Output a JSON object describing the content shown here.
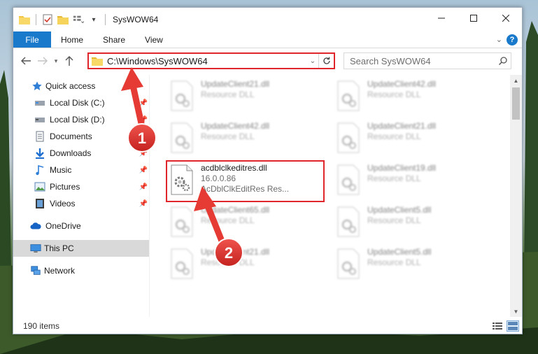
{
  "window": {
    "title": "SysWOW64",
    "controls": {
      "minimize": "—",
      "maximize": "☐",
      "close": "✕"
    }
  },
  "ribbon": {
    "tabs": [
      "File",
      "Home",
      "Share",
      "View"
    ],
    "help": "?"
  },
  "address": {
    "path": "C:\\Windows\\SysWOW64",
    "search_placeholder": "Search SysWOW64"
  },
  "nav": {
    "items": [
      {
        "label": "Quick access",
        "icon": "star-icon"
      },
      {
        "label": "Local Disk (C:)",
        "icon": "drive-icon",
        "pinned": true
      },
      {
        "label": "Local Disk (D:)",
        "icon": "drive-icon",
        "pinned": true
      },
      {
        "label": "Documents",
        "icon": "documents-icon",
        "pinned": true
      },
      {
        "label": "Downloads",
        "icon": "downloads-icon",
        "pinned": true
      },
      {
        "label": "Music",
        "icon": "music-icon",
        "pinned": true
      },
      {
        "label": "Pictures",
        "icon": "pictures-icon",
        "pinned": true
      },
      {
        "label": "Videos",
        "icon": "videos-icon",
        "pinned": true
      },
      {
        "label": "OneDrive",
        "icon": "onedrive-icon"
      },
      {
        "label": "This PC",
        "icon": "computer-icon",
        "selected": true
      },
      {
        "label": "Network",
        "icon": "network-icon"
      }
    ]
  },
  "files": {
    "left": [
      {
        "name": "UpdateClient21.dll",
        "type": "Resource DLL"
      },
      {
        "name": "UpdateClient42.dll",
        "type": "Resource DLL"
      },
      {
        "name": "acdblclkeditres.dll",
        "version": "16.0.0.86",
        "description": "AcDblClkEditRes Res..."
      },
      {
        "name": "UpdateClient65.dll",
        "type": "Resource DLL"
      },
      {
        "name": "UpdateClient21.dll",
        "type": "Resource DLL"
      }
    ],
    "right": [
      {
        "name": "UpdateClient42.dll",
        "type": "Resource DLL"
      },
      {
        "name": "UpdateClient21.dll",
        "type": "Resource DLL"
      },
      {
        "name": "UpdateClient19.dll",
        "type": "Resource DLL"
      },
      {
        "name": "UpdateClient5.dll",
        "type": "Resource DLL"
      },
      {
        "name": "UpdateClient5.dll",
        "type": "Resource DLL"
      }
    ]
  },
  "status": {
    "item_count": "190 items"
  },
  "annotations": {
    "step1": "1",
    "step2": "2"
  },
  "colors": {
    "accent": "#1979ca",
    "highlight": "#e0262b",
    "selected_nav": "#d9d9d9"
  }
}
